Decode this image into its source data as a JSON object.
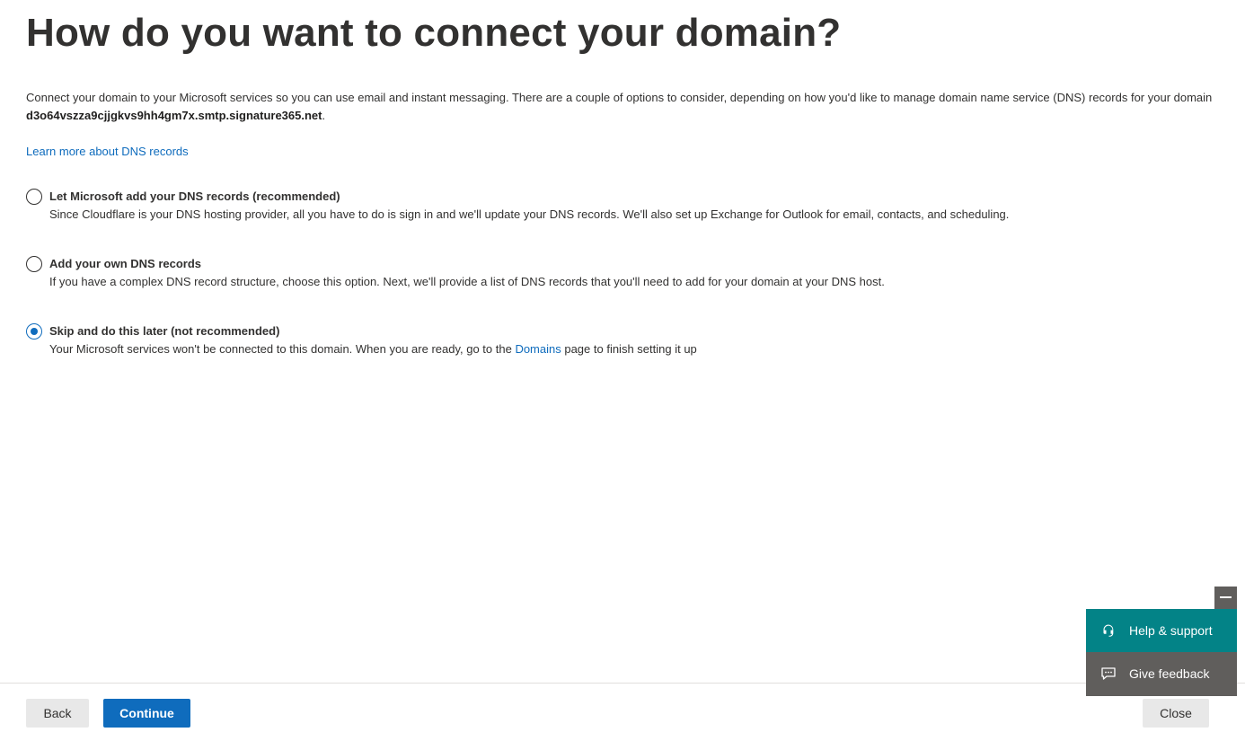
{
  "page": {
    "title": "How do you want to connect your domain?",
    "intro_text": "Connect your domain to your Microsoft services so you can use email and instant messaging. There are a couple of options to consider, depending on how you'd like to manage domain name service (DNS) records for your domain ",
    "domain_name": "d3o64vszza9cjjgkvs9hh4gm7x.smtp.signature365.net",
    "intro_suffix": ".",
    "learn_more_link": "Learn more about DNS records"
  },
  "options": [
    {
      "title": "Let Microsoft add your DNS records (recommended)",
      "description": "Since Cloudflare is your DNS hosting provider, all you have to do is sign in and we'll update your DNS records. We'll also set up Exchange for Outlook for email, contacts, and scheduling.",
      "selected": false
    },
    {
      "title": "Add your own DNS records",
      "description": "If you have a complex DNS record structure, choose this option. Next, we'll provide a list of DNS records that you'll need to add for your domain at your DNS host.",
      "selected": false
    },
    {
      "title": "Skip and do this later (not recommended)",
      "description_before": "Your Microsoft services won't be connected to this domain. When you are ready, go to the ",
      "description_link": "Domains",
      "description_after": " page to finish setting it up",
      "selected": true
    }
  ],
  "footer": {
    "back_label": "Back",
    "continue_label": "Continue",
    "close_label": "Close"
  },
  "support_panel": {
    "help_label": "Help & support",
    "feedback_label": "Give feedback"
  },
  "colors": {
    "accent": "#0f6cbd",
    "help_bg": "#038387",
    "feedback_bg": "#605e5c"
  },
  "icons": {
    "minimize": "minimize-icon",
    "help": "headset-icon",
    "feedback": "feedback-chat-icon"
  }
}
